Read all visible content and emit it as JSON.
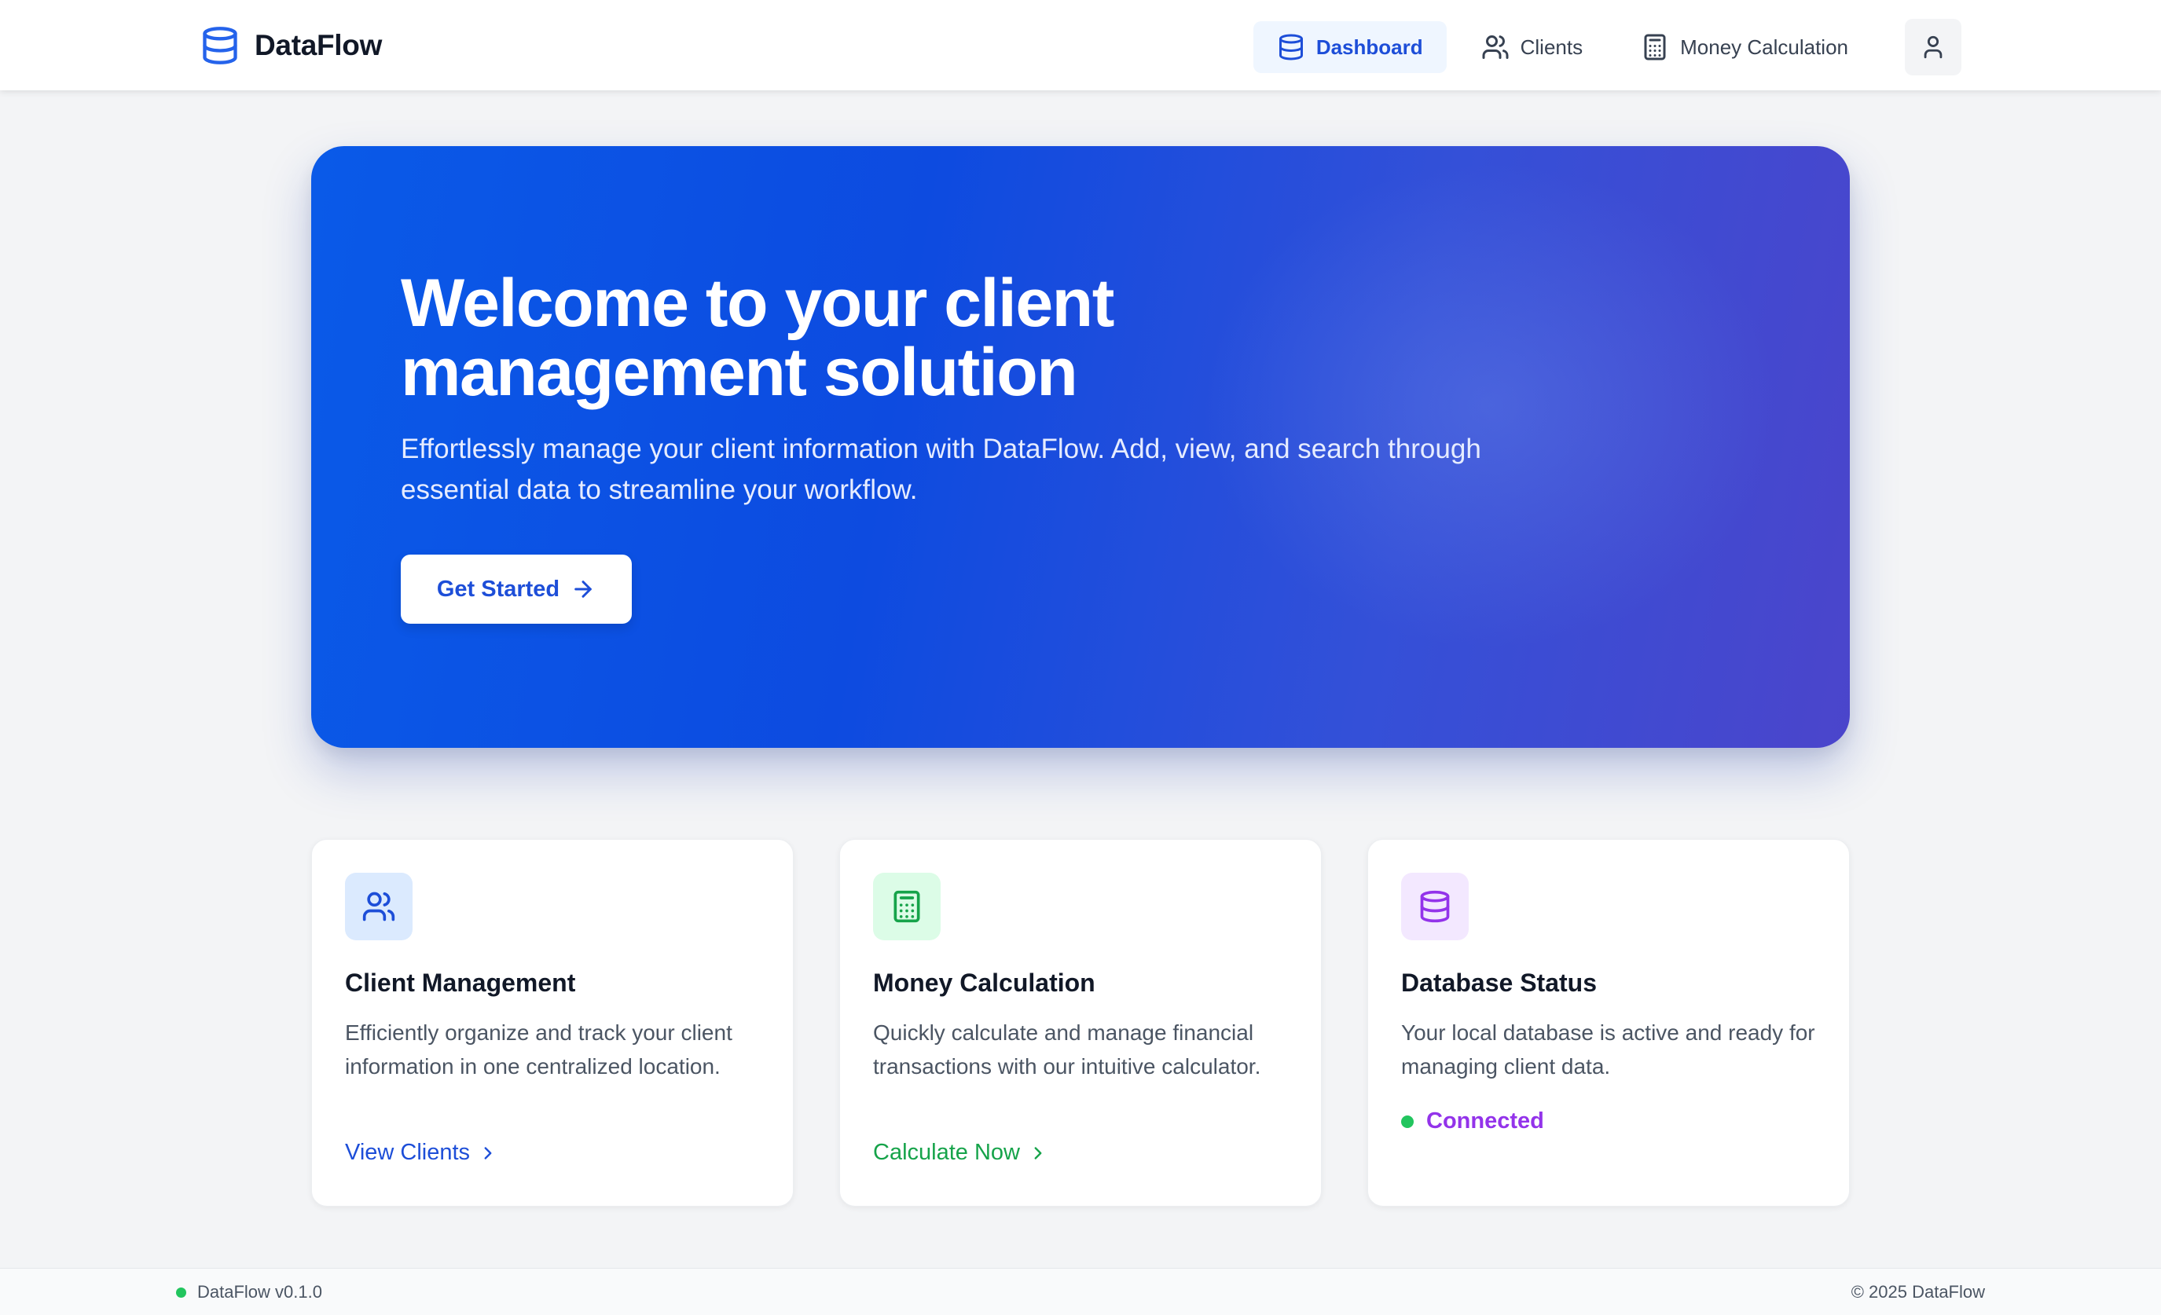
{
  "app": {
    "name": "DataFlow"
  },
  "nav": {
    "items": [
      {
        "label": "Dashboard",
        "icon": "database-icon",
        "active": true
      },
      {
        "label": "Clients",
        "icon": "users-icon",
        "active": false
      },
      {
        "label": "Money Calculation",
        "icon": "calculator-icon",
        "active": false
      }
    ],
    "profile_icon": "user-icon"
  },
  "hero": {
    "title": "Welcome to your client management solution",
    "subtitle": "Effortlessly manage your client information with DataFlow. Add, view, and search through essential data to streamline your workflow.",
    "cta_label": "Get Started",
    "cta_icon": "arrow-right-icon"
  },
  "cards": [
    {
      "title": "Client Management",
      "description": "Efficiently organize and track your client information in one centralized location.",
      "link_label": "View Clients",
      "icon": "users-icon",
      "accent": "#1d4ed8",
      "icon_bg": "#dbeafe"
    },
    {
      "title": "Money Calculation",
      "description": "Quickly calculate and manage financial transactions with our intuitive calculator.",
      "link_label": "Calculate Now",
      "icon": "calculator-icon",
      "accent": "#16a34a",
      "icon_bg": "#dcfce7"
    },
    {
      "title": "Database Status",
      "description": "Your local database is active and ready for managing client data.",
      "status_label": "Connected",
      "icon": "database-icon",
      "accent": "#9333ea",
      "icon_bg": "#f3e8ff"
    }
  ],
  "footer": {
    "version": "DataFlow v0.1.0",
    "copyright": "© 2025 DataFlow"
  },
  "colors": {
    "brand_blue": "#2563eb",
    "status_green": "#22c55e",
    "hero_gradient_start": "#0a5ae8",
    "hero_gradient_end": "#4b45cb"
  }
}
